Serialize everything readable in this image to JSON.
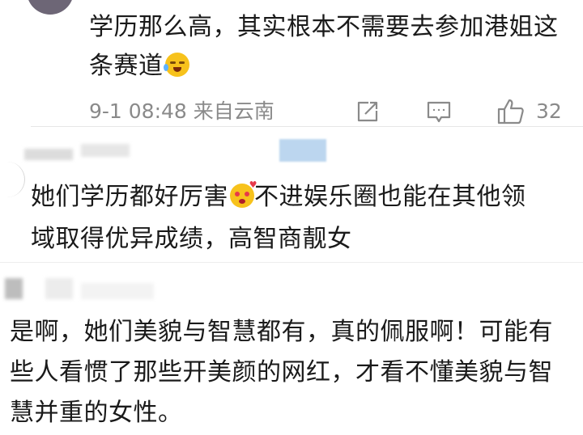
{
  "comments": [
    {
      "text": "学历那么高，其实根本不需要去参加港姐这条赛道",
      "emoji": "crying-laughing-emoji",
      "time": "9-1 08:48",
      "source": "来自云南",
      "likes": "32"
    },
    {
      "text": "她们学历都好厉害",
      "emoji": "heart-face-emoji",
      "text_after": "不进娱乐圈也能在其他领域取得优异成绩，高智商靓女"
    },
    {
      "text": "是啊，她们美貌与智慧都有，真的佩服啊！可能有些人看惯了那些开美颜的网红，才看不懂美貌与智慧并重的女性。"
    }
  ],
  "colors": {
    "text": "#1a1a1a",
    "meta": "#8a8a8a",
    "emoji": "#f7c21c"
  }
}
